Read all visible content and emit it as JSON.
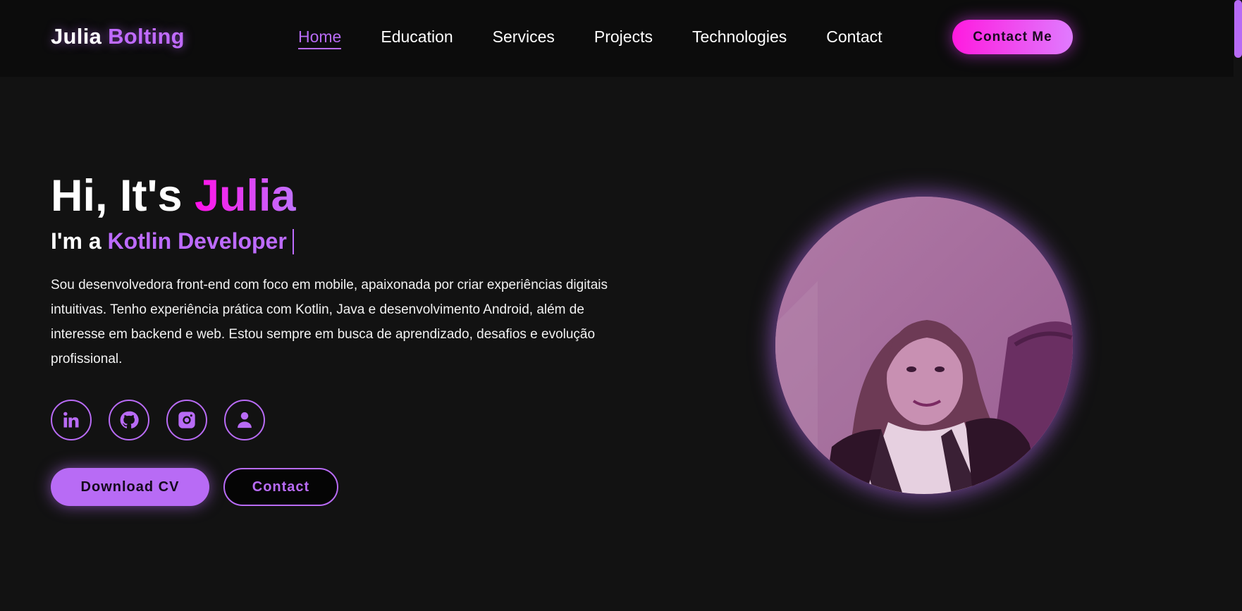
{
  "colors": {
    "background": "#121212",
    "header": "#0c0c0c",
    "accent": "#b86bf5",
    "magenta": "#ff10e8"
  },
  "logo": {
    "first": "Julia",
    "last": "Bolting"
  },
  "nav": {
    "items": [
      {
        "label": "Home",
        "active": true
      },
      {
        "label": "Education",
        "active": false
      },
      {
        "label": "Services",
        "active": false
      },
      {
        "label": "Projects",
        "active": false
      },
      {
        "label": "Technologies",
        "active": false
      },
      {
        "label": "Contact",
        "active": false
      }
    ],
    "cta_label": "Contact Me"
  },
  "hero": {
    "greeting": "Hi, It's ",
    "name": "Julia",
    "subtitle_prefix": "I'm a ",
    "role": "Kotlin Developer",
    "description": "Sou desenvolvedora front-end com foco em mobile, apaixonada por criar experiências digitais intuitivas. Tenho experiência prática com Kotlin, Java e desenvolvimento Android, além de interesse em backend e web. Estou sempre em busca de aprendizado, desafios e evolução profissional.",
    "socials": [
      {
        "icon": "linkedin-icon"
      },
      {
        "icon": "github-icon"
      },
      {
        "icon": "instagram-icon"
      },
      {
        "icon": "user-icon"
      }
    ],
    "download_label": "Download CV",
    "contact_label": "Contact"
  }
}
